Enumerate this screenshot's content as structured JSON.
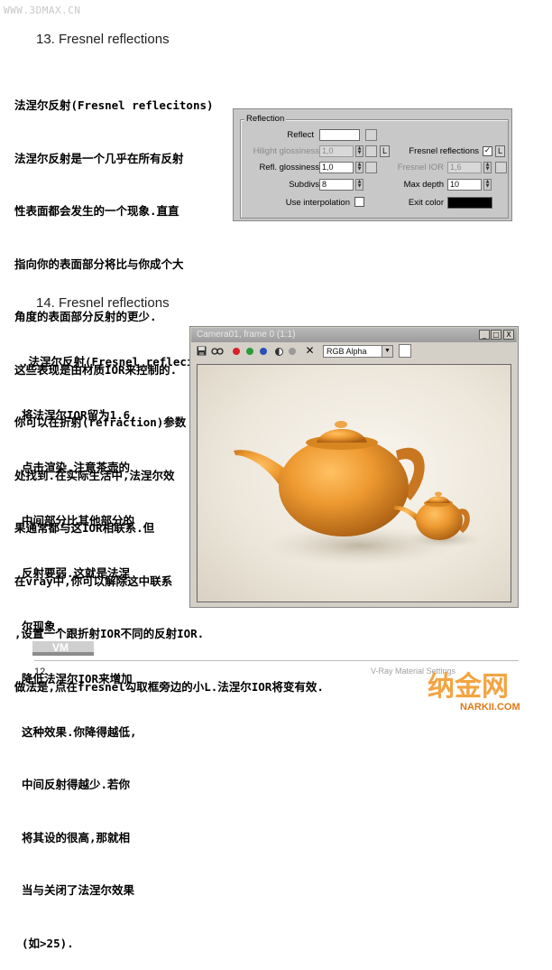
{
  "watermark": "WWW.3DMAX.CN",
  "section13": {
    "title": "13. Fresnel reflections",
    "lines": [
      "法涅尔反射(Fresnel reflecitons)",
      "法涅尔反射是一个几乎在所有反射",
      "性表面都会发生的一个现象.直直",
      "指向你的表面部分将比与你成个大",
      "角度的表面部分反射的更少.",
      "这些表现是由材质IOR来控制的.",
      "你可以在折射(refraction)参数",
      "处找到.在实际生活中,法涅尔效",
      "果通常都与这IOR相联系.但",
      "在vray中,你可以解除这中联系",
      ",设置一个跟折射IOR不同的反射IOR.",
      "做法是,点在fresnel勾取框旁边的小L.法涅尔IOR将变有效."
    ]
  },
  "reflection_panel": {
    "group_title": "Reflection",
    "reflect_label": "Reflect",
    "hilight_label": "Hilight glossiness",
    "hilight_value": "1,0",
    "refl_gloss_label": "Refl. glossiness",
    "refl_gloss_value": "1,0",
    "subdivs_label": "Subdivs",
    "subdivs_value": "8",
    "use_interp_label": "Use interpolation",
    "fresnel_label": "Fresnel reflections",
    "fresnel_checked": "✓",
    "fresnel_ior_label": "Fresnel IOR",
    "fresnel_ior_value": "1,6",
    "max_depth_label": "Max depth",
    "max_depth_value": "10",
    "exit_color_label": "Exit color",
    "l_button": "L",
    "reflect_color": "#ffffff",
    "exit_color": "#000000"
  },
  "section14": {
    "title": "14. Fresnel reflections",
    "lines": [
      ".法涅尔反射(Fresnel reflecitons)",
      "将法涅尔IOR留为1.6,",
      "点击渲染.注意茶壶的",
      "中间部分比其他部分的",
      "反射要弱.这就是法涅",
      "尔现象.",
      "降低法涅尔IOR来增加",
      "这种效果.你降得越低,",
      "中间反射得越少.若你",
      "将其设的很高,那就相",
      "当与关闭了法涅尔效果",
      "(如>25)."
    ]
  },
  "render_window": {
    "title": "Camera01, frame 0 (1:1)",
    "channel": "RGB Alpha",
    "min_btn": "_",
    "max_btn": "□",
    "close_btn": "X",
    "teapot_color": "#e8962e"
  },
  "footer": {
    "page_number": "12",
    "right_text": "V-Ray Material Settings",
    "logo_text": "VM",
    "brand_cn": "纳金网",
    "brand_url": "NARKII.COM"
  }
}
